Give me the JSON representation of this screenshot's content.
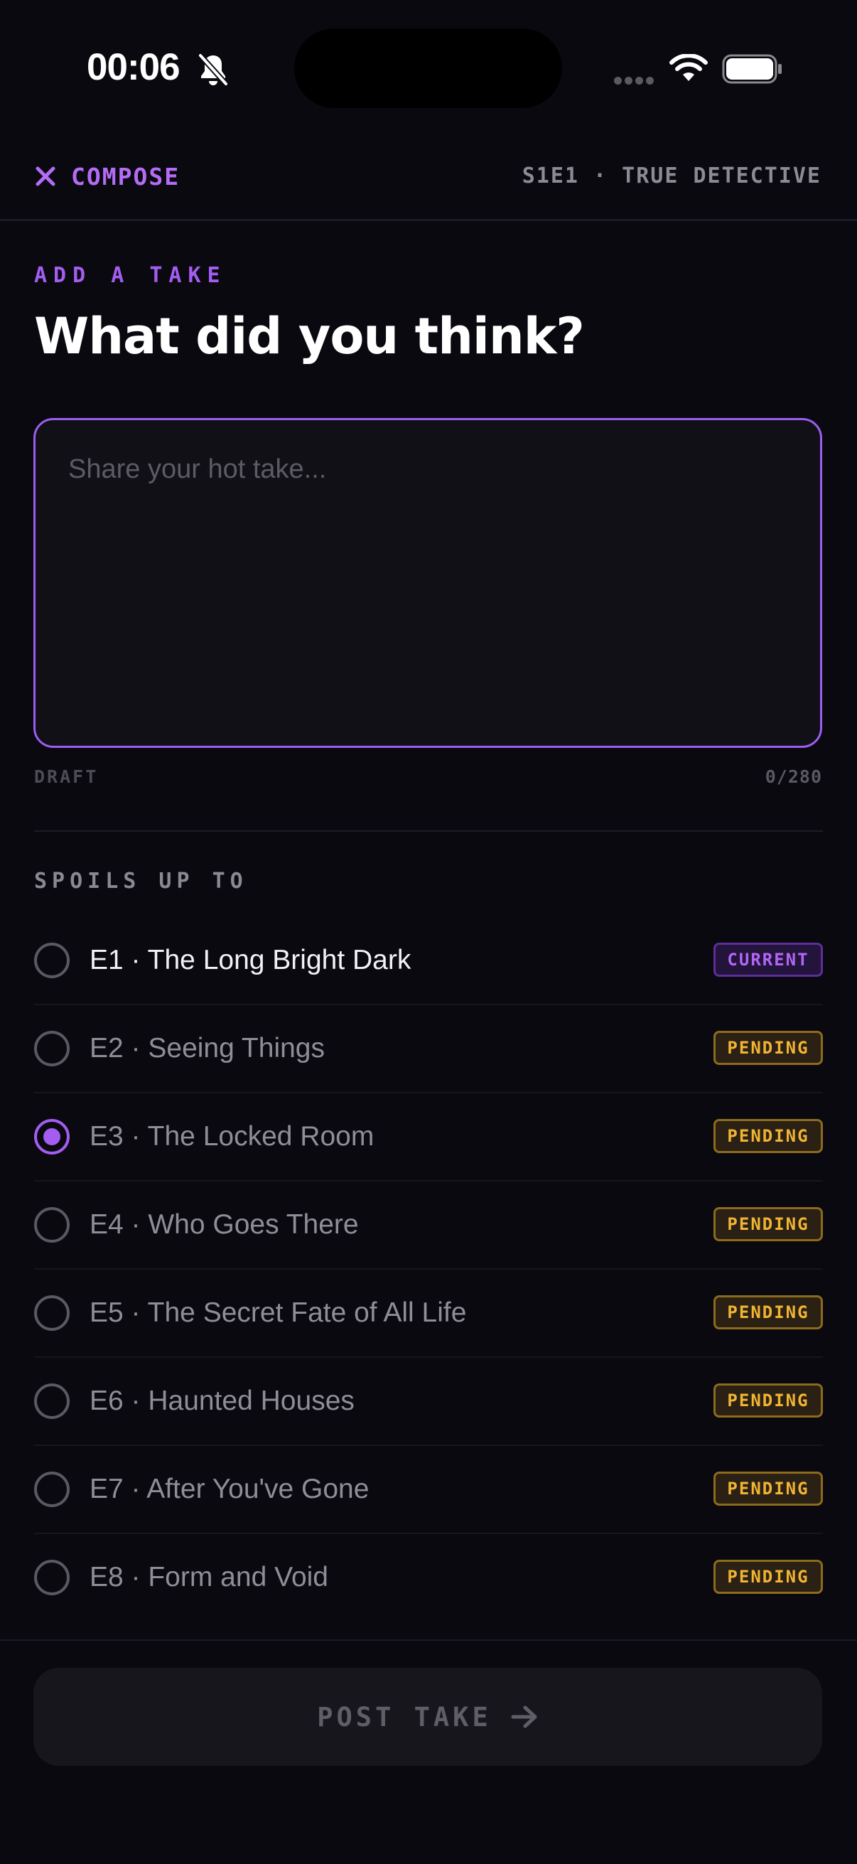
{
  "status_bar": {
    "time": "00:06"
  },
  "header": {
    "close_label": "COMPOSE",
    "episode_context": "S1E1 · TRUE DETECTIVE"
  },
  "compose": {
    "eyebrow": "ADD A TAKE",
    "title": "What did you think?",
    "input_value": "",
    "input_placeholder": "Share your hot take...",
    "draft_label": "DRAFT",
    "char_count": "0/280"
  },
  "spoilers": {
    "section_label": "SPOILS UP TO",
    "selected_index": 2,
    "episodes": [
      {
        "label": "E1 · The Long Bright Dark",
        "badge": "CURRENT",
        "status": "current"
      },
      {
        "label": "E2 · Seeing Things",
        "badge": "PENDING",
        "status": "pending"
      },
      {
        "label": "E3 · The Locked Room",
        "badge": "PENDING",
        "status": "pending"
      },
      {
        "label": "E4 · Who Goes There",
        "badge": "PENDING",
        "status": "pending"
      },
      {
        "label": "E5 · The Secret Fate of All Life",
        "badge": "PENDING",
        "status": "pending"
      },
      {
        "label": "E6 · Haunted Houses",
        "badge": "PENDING",
        "status": "pending"
      },
      {
        "label": "E7 · After You've Gone",
        "badge": "PENDING",
        "status": "pending"
      },
      {
        "label": "E8 · Form and Void",
        "badge": "PENDING",
        "status": "pending"
      }
    ]
  },
  "footer": {
    "post_label": "POST TAKE",
    "post_icon": "arrow-right-icon"
  },
  "colors": {
    "accent": "#a35df0",
    "pending": "#f1b433",
    "background": "#0a0910"
  }
}
